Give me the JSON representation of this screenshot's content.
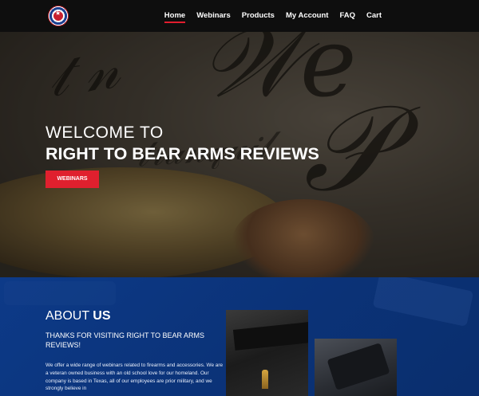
{
  "nav": {
    "items": [
      {
        "label": "Home",
        "active": true
      },
      {
        "label": "Webinars",
        "active": false
      },
      {
        "label": "Products",
        "active": false
      },
      {
        "label": "My Account",
        "active": false
      },
      {
        "label": "FAQ",
        "active": false
      },
      {
        "label": "Cart",
        "active": false
      }
    ],
    "accent": "#e21d2e"
  },
  "hero": {
    "line1": "WELCOME TO",
    "line2": "RIGHT TO BEAR ARMS REVIEWS",
    "button": "WEBINARS"
  },
  "about": {
    "title_a": "ABOUT",
    "title_b": "US",
    "subtitle": "THANKS FOR VISITING RIGHT TO BEAR ARMS REVIEWS!",
    "body": "We offer a wide range of webinars related to firearms and accessories. We are a veteran owned business with an old school love for our homeland. Our company is based in Texas, all of our employees are prior military, and we strongly believe in",
    "bg_color": "#0d3a88"
  }
}
